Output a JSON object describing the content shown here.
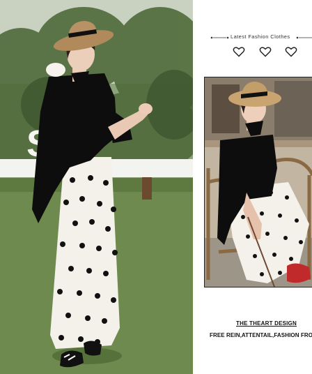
{
  "tagline": "Latest Fashion Clothes",
  "hearts": [
    "heart-icon",
    "heart-icon",
    "heart-icon"
  ],
  "brand": {
    "title": "THE THEART DESIGN",
    "subtitle": "FREE REIN,ATTENTAIL,FASHION FRO"
  },
  "sign_letters": "SU",
  "colors": {
    "background": "#ffffff",
    "text": "#111111",
    "grass": "#6f8a4f",
    "top": "#0d0d0d",
    "skirt": "#f4f1ea",
    "hat": "#b08a5a"
  }
}
